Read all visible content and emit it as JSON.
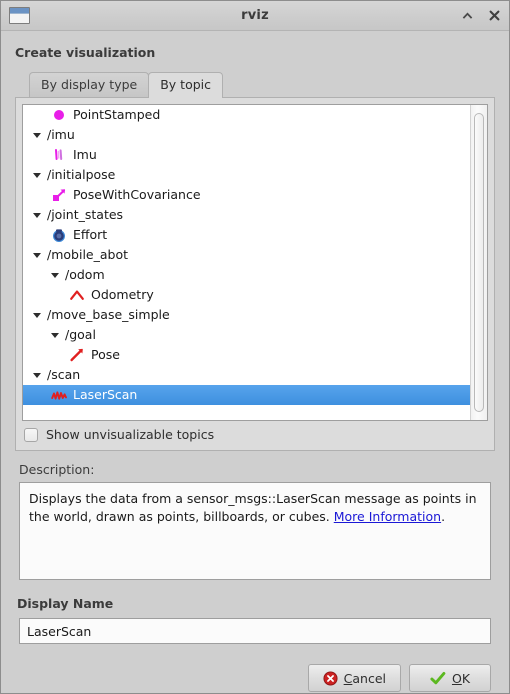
{
  "window": {
    "title": "rviz",
    "icon": "window-icon",
    "buttons": [
      {
        "name": "shade-button",
        "icon": "chevron-up-icon"
      },
      {
        "name": "close-button",
        "icon": "close-icon"
      }
    ]
  },
  "dialog": {
    "heading": "Create visualization"
  },
  "tabs": [
    {
      "label": "By display type",
      "active": false
    },
    {
      "label": "By topic",
      "active": true
    }
  ],
  "tree": {
    "rows": [
      {
        "type": "leaf",
        "indent": 2,
        "icon": "point-stamped-icon",
        "label": "PointStamped",
        "selected": false
      },
      {
        "type": "branch",
        "indent": 1,
        "icon": "triangle-down-icon",
        "label": "/imu",
        "selected": false
      },
      {
        "type": "leaf",
        "indent": 2,
        "icon": "imu-icon",
        "label": "Imu",
        "selected": false
      },
      {
        "type": "branch",
        "indent": 1,
        "icon": "triangle-down-icon",
        "label": "/initialpose",
        "selected": false
      },
      {
        "type": "leaf",
        "indent": 2,
        "icon": "pose-with-covariance-icon",
        "label": "PoseWithCovariance",
        "selected": false
      },
      {
        "type": "branch",
        "indent": 1,
        "icon": "triangle-down-icon",
        "label": "/joint_states",
        "selected": false
      },
      {
        "type": "leaf",
        "indent": 2,
        "icon": "effort-icon",
        "label": "Effort",
        "selected": false
      },
      {
        "type": "branch",
        "indent": 1,
        "icon": "triangle-down-icon",
        "label": "/mobile_abot",
        "selected": false
      },
      {
        "type": "branch",
        "indent": 2,
        "icon": "triangle-down-icon",
        "label": "/odom",
        "selected": false
      },
      {
        "type": "leaf",
        "indent": 3,
        "icon": "odometry-icon",
        "label": "Odometry",
        "selected": false
      },
      {
        "type": "branch",
        "indent": 1,
        "icon": "triangle-down-icon",
        "label": "/move_base_simple",
        "selected": false
      },
      {
        "type": "branch",
        "indent": 2,
        "icon": "triangle-down-icon",
        "label": "/goal",
        "selected": false
      },
      {
        "type": "leaf",
        "indent": 3,
        "icon": "pose-icon",
        "label": "Pose",
        "selected": false
      },
      {
        "type": "branch",
        "indent": 1,
        "icon": "triangle-down-icon",
        "label": "/scan",
        "selected": false
      },
      {
        "type": "leaf",
        "indent": 2,
        "icon": "laser-scan-icon",
        "label": "LaserScan",
        "selected": true
      }
    ]
  },
  "show_unvisualizable": {
    "label": "Show unvisualizable topics",
    "checked": false
  },
  "description": {
    "label": "Description:",
    "text_before": "Displays the data from a sensor_msgs::LaserScan message as points in the world, drawn as points, billboards, or cubes. ",
    "link_text": "More Information",
    "text_after": "."
  },
  "display_name": {
    "label": "Display Name",
    "value": "LaserScan"
  },
  "buttons": {
    "cancel": {
      "pre": "",
      "mnemonic": "C",
      "post": "ancel",
      "icon": "error-circle-icon"
    },
    "ok": {
      "pre": "",
      "mnemonic": "O",
      "post": "K",
      "icon": "check-icon"
    }
  },
  "colors": {
    "selection_blue": "#3e90df",
    "link_blue": "#1b18d6",
    "magenta": "#e81ee8",
    "red": "#e02020",
    "dialog_bg": "#cfcfcf"
  }
}
